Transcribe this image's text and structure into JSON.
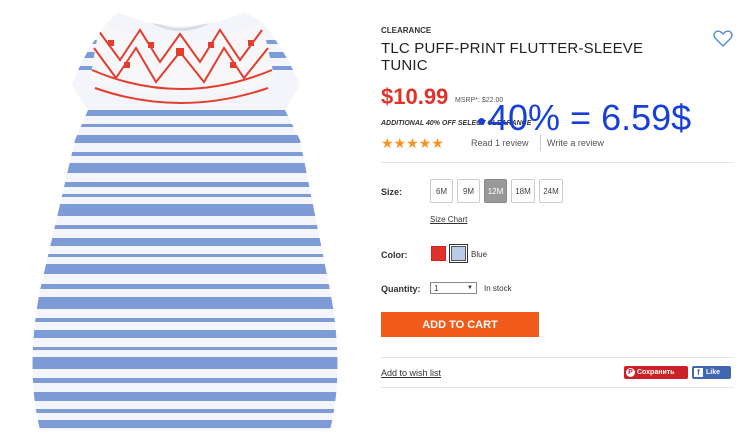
{
  "product": {
    "eyebrow": "CLEARANCE",
    "title": "TLC PUFF-PRINT FLUTTER-SLEEVE TUNIC",
    "price": "$10.99",
    "msrp": "MSRP*: $22.00",
    "promo": "ADDITIONAL 40% OFF SELECT CLEARANCE",
    "overlay_note": "40% = 6.59$"
  },
  "reviews": {
    "stars": "★★★★★",
    "read_label": "Read 1 review",
    "write_label": "Write a review"
  },
  "size": {
    "label": "Size:",
    "options": [
      "6M",
      "9M",
      "12M",
      "18M",
      "24M"
    ],
    "selected": "12M",
    "chart_link": "Size Chart"
  },
  "color": {
    "label": "Color:",
    "selected_name": "Blue",
    "swatches": [
      "#e0322b",
      "#b9cbe6"
    ]
  },
  "quantity": {
    "label": "Quantity:",
    "value": "1",
    "stock": "In stock"
  },
  "actions": {
    "add_to_cart": "ADD TO CART",
    "wishlist": "Add to wish list",
    "pin_label": "Сохранить",
    "fb_label": "Like"
  },
  "colors": {
    "price": "#e0322b",
    "cta": "#f05a1a",
    "overlay": "#1740d8",
    "stars": "#f6921e"
  }
}
